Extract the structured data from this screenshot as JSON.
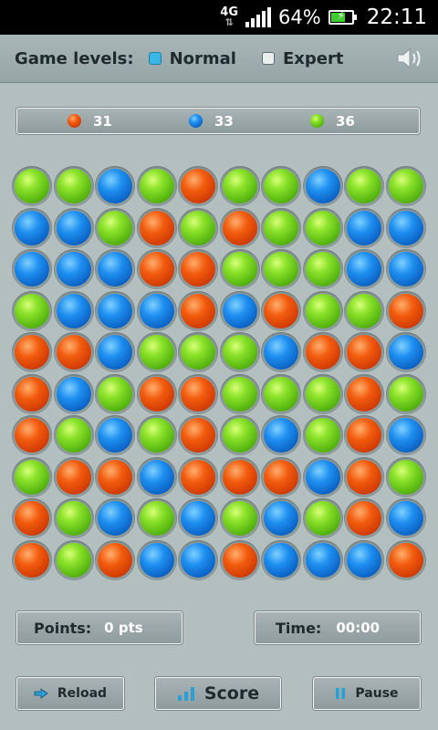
{
  "status_bar": {
    "network": "4G",
    "battery": "64%",
    "time": "22:11"
  },
  "header": {
    "levels_label": "Game levels:",
    "options": [
      {
        "label": "Normal",
        "selected": true
      },
      {
        "label": "Expert",
        "selected": false
      }
    ],
    "sound_icon": "speaker-icon"
  },
  "counters": [
    {
      "color": "orange",
      "count": "31"
    },
    {
      "color": "blue",
      "count": "33"
    },
    {
      "color": "green",
      "count": "36"
    }
  ],
  "colors": {
    "orange": "#e8500a",
    "blue": "#1380e0",
    "green": "#74d21e"
  },
  "board": [
    [
      "green",
      "green",
      "blue",
      "green",
      "orange",
      "green",
      "green",
      "blue",
      "green",
      "green"
    ],
    [
      "blue",
      "blue",
      "green",
      "orange",
      "green",
      "orange",
      "green",
      "green",
      "blue",
      "blue"
    ],
    [
      "blue",
      "blue",
      "blue",
      "orange",
      "orange",
      "green",
      "green",
      "green",
      "blue",
      "blue"
    ],
    [
      "green",
      "blue",
      "blue",
      "blue",
      "orange",
      "blue",
      "orange",
      "green",
      "green",
      "orange"
    ],
    [
      "orange",
      "orange",
      "blue",
      "green",
      "green",
      "green",
      "blue",
      "orange",
      "orange",
      "blue"
    ],
    [
      "orange",
      "blue",
      "green",
      "orange",
      "orange",
      "green",
      "green",
      "green",
      "orange",
      "green"
    ],
    [
      "orange",
      "green",
      "blue",
      "green",
      "orange",
      "green",
      "blue",
      "green",
      "orange",
      "blue"
    ],
    [
      "green",
      "orange",
      "orange",
      "blue",
      "orange",
      "orange",
      "orange",
      "blue",
      "orange",
      "green"
    ],
    [
      "orange",
      "green",
      "blue",
      "green",
      "blue",
      "green",
      "blue",
      "green",
      "orange",
      "blue"
    ],
    [
      "orange",
      "green",
      "orange",
      "blue",
      "blue",
      "orange",
      "blue",
      "blue",
      "blue",
      "orange"
    ]
  ],
  "points": {
    "label": "Points:",
    "value": "0 pts"
  },
  "time": {
    "label": "Time:",
    "value": "00:00"
  },
  "buttons": {
    "reload": "Reload",
    "score": "Score",
    "pause": "Pause"
  }
}
